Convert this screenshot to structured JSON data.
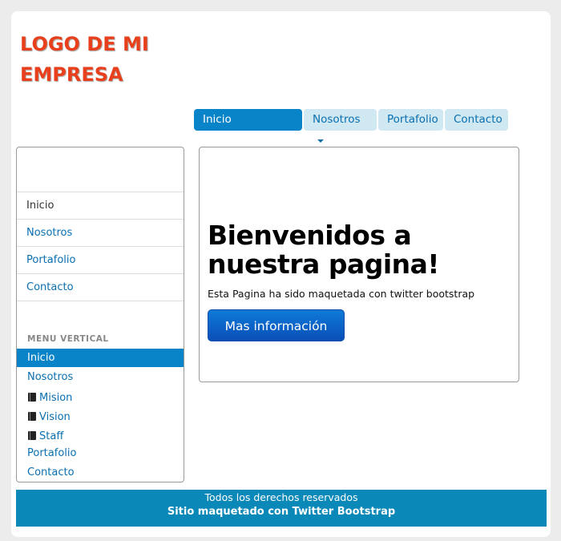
{
  "logo": {
    "line1": "LOGO DE MI",
    "line2": "EMPRESA"
  },
  "topnav": [
    {
      "label": "Inicio",
      "active": true
    },
    {
      "label": "Nosotros",
      "dropdown": true
    },
    {
      "label": "Portafolio"
    },
    {
      "label": "Contacto"
    }
  ],
  "sidebar": {
    "list": [
      "Inicio",
      "Nosotros",
      "Portafolio",
      "Contacto"
    ],
    "vertical_header": "MENU VERTICAL",
    "vertical": [
      "Inicio",
      "Nosotros",
      "Mision",
      "Vision",
      "Staff",
      "Portafolio",
      "Contacto"
    ]
  },
  "hero": {
    "title_line1": "Bienvenidos a",
    "title_line2": "nuestra pagina!",
    "subtitle": "Esta Pagina ha sido maquetada con twitter bootstrap",
    "button": "Mas información"
  },
  "footer": {
    "line1": "Todos los derechos reservados",
    "line2": "Sitio maquetado con Twitter Bootstrap"
  },
  "colors": {
    "logo": "#e8401c",
    "accent": "#0a84c8",
    "tab": "#cfe8f2",
    "footer": "#0a88b8"
  }
}
